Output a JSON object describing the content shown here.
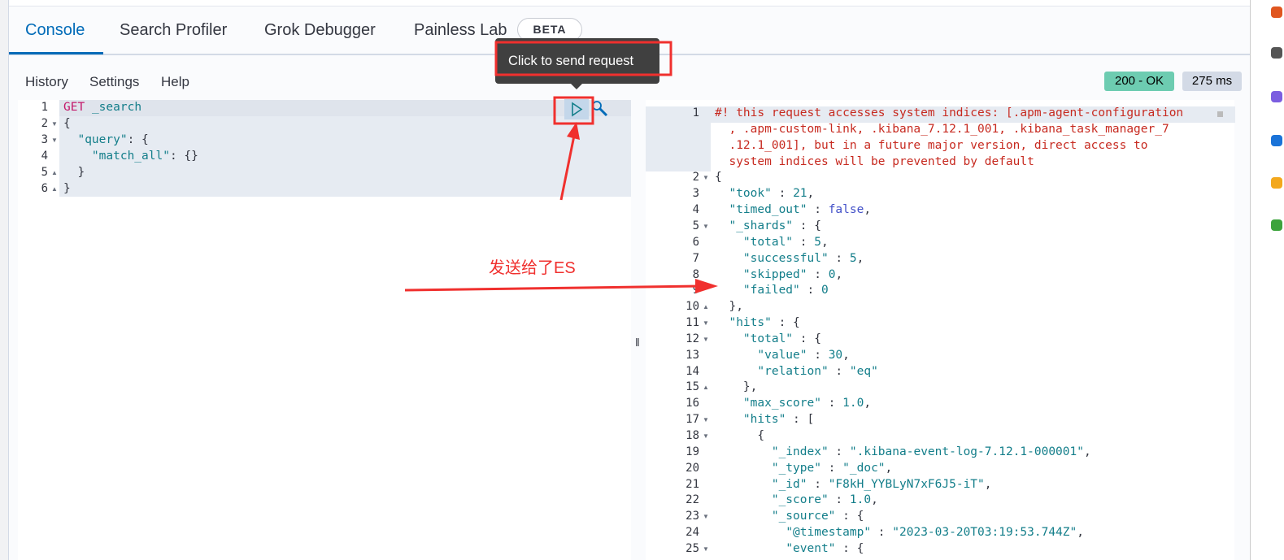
{
  "tabs": [
    {
      "label": "Console",
      "active": true
    },
    {
      "label": "Search Profiler"
    },
    {
      "label": "Grok Debugger"
    },
    {
      "label": "Painless Lab"
    }
  ],
  "beta_badge": "BETA",
  "menu": {
    "history": "History",
    "settings": "Settings",
    "help": "Help"
  },
  "status": {
    "code": "200 - OK",
    "time": "275 ms",
    "ok_color": "#6dccb1",
    "time_color": "#d3dae6"
  },
  "tooltip": "Click to send request",
  "annotation": "发送给了ES",
  "request_lines": [
    {
      "n": "1",
      "fold": "",
      "seg": [
        [
          "m",
          "GET"
        ],
        [
          "p",
          " "
        ],
        [
          "n",
          "_search"
        ]
      ]
    },
    {
      "n": "2",
      "fold": "▼",
      "seg": [
        [
          "p",
          "{"
        ]
      ]
    },
    {
      "n": "3",
      "fold": "▼",
      "seg": [
        [
          "p",
          "  "
        ],
        [
          "k",
          "\"query\""
        ],
        [
          "p",
          ": {"
        ]
      ]
    },
    {
      "n": "4",
      "fold": "",
      "seg": [
        [
          "p",
          "    "
        ],
        [
          "k",
          "\"match_all\""
        ],
        [
          "p",
          ": {}"
        ]
      ]
    },
    {
      "n": "5",
      "fold": "▲",
      "seg": [
        [
          "p",
          "  }"
        ]
      ]
    },
    {
      "n": "6",
      "fold": "▲",
      "seg": [
        [
          "p",
          "}"
        ]
      ]
    }
  ],
  "response_lines": [
    {
      "n": "1",
      "fold": "",
      "seg": [
        [
          "c",
          "#! this request accesses system indices: [.apm-agent-configuration"
        ]
      ]
    },
    {
      "n": "",
      "fold": "",
      "seg": [
        [
          "c",
          "  , .apm-custom-link, .kibana_7.12.1_001, .kibana_task_manager_7"
        ]
      ]
    },
    {
      "n": "",
      "fold": "",
      "seg": [
        [
          "c",
          "  .12.1_001], but in a future major version, direct access to"
        ]
      ]
    },
    {
      "n": "",
      "fold": "",
      "seg": [
        [
          "c",
          "  system indices will be prevented by default"
        ]
      ]
    },
    {
      "n": "2",
      "fold": "▼",
      "seg": [
        [
          "p",
          "{"
        ]
      ]
    },
    {
      "n": "3",
      "fold": "",
      "seg": [
        [
          "p",
          "  "
        ],
        [
          "k",
          "\"took\""
        ],
        [
          "p",
          " : "
        ],
        [
          "n",
          "21"
        ],
        [
          "p",
          ","
        ]
      ]
    },
    {
      "n": "4",
      "fold": "",
      "seg": [
        [
          "p",
          "  "
        ],
        [
          "k",
          "\"timed_out\""
        ],
        [
          "p",
          " : "
        ],
        [
          "b",
          "false"
        ],
        [
          "p",
          ","
        ]
      ]
    },
    {
      "n": "5",
      "fold": "▼",
      "seg": [
        [
          "p",
          "  "
        ],
        [
          "k",
          "\"_shards\""
        ],
        [
          "p",
          " : {"
        ]
      ]
    },
    {
      "n": "6",
      "fold": "",
      "seg": [
        [
          "p",
          "    "
        ],
        [
          "k",
          "\"total\""
        ],
        [
          "p",
          " : "
        ],
        [
          "n",
          "5"
        ],
        [
          "p",
          ","
        ]
      ]
    },
    {
      "n": "7",
      "fold": "",
      "seg": [
        [
          "p",
          "    "
        ],
        [
          "k",
          "\"successful\""
        ],
        [
          "p",
          " : "
        ],
        [
          "n",
          "5"
        ],
        [
          "p",
          ","
        ]
      ]
    },
    {
      "n": "8",
      "fold": "",
      "seg": [
        [
          "p",
          "    "
        ],
        [
          "k",
          "\"skipped\""
        ],
        [
          "p",
          " : "
        ],
        [
          "n",
          "0"
        ],
        [
          "p",
          ","
        ]
      ]
    },
    {
      "n": "9",
      "fold": "",
      "seg": [
        [
          "p",
          "    "
        ],
        [
          "k",
          "\"failed\""
        ],
        [
          "p",
          " : "
        ],
        [
          "n",
          "0"
        ]
      ]
    },
    {
      "n": "10",
      "fold": "▲",
      "seg": [
        [
          "p",
          "  },"
        ]
      ]
    },
    {
      "n": "11",
      "fold": "▼",
      "seg": [
        [
          "p",
          "  "
        ],
        [
          "k",
          "\"hits\""
        ],
        [
          "p",
          " : {"
        ]
      ]
    },
    {
      "n": "12",
      "fold": "▼",
      "seg": [
        [
          "p",
          "    "
        ],
        [
          "k",
          "\"total\""
        ],
        [
          "p",
          " : {"
        ]
      ]
    },
    {
      "n": "13",
      "fold": "",
      "seg": [
        [
          "p",
          "      "
        ],
        [
          "k",
          "\"value\""
        ],
        [
          "p",
          " : "
        ],
        [
          "n",
          "30"
        ],
        [
          "p",
          ","
        ]
      ]
    },
    {
      "n": "14",
      "fold": "",
      "seg": [
        [
          "p",
          "      "
        ],
        [
          "k",
          "\"relation\""
        ],
        [
          "p",
          " : "
        ],
        [
          "s",
          "\"eq\""
        ]
      ]
    },
    {
      "n": "15",
      "fold": "▲",
      "seg": [
        [
          "p",
          "    },"
        ]
      ]
    },
    {
      "n": "16",
      "fold": "",
      "seg": [
        [
          "p",
          "    "
        ],
        [
          "k",
          "\"max_score\""
        ],
        [
          "p",
          " : "
        ],
        [
          "n",
          "1.0"
        ],
        [
          "p",
          ","
        ]
      ]
    },
    {
      "n": "17",
      "fold": "▼",
      "seg": [
        [
          "p",
          "    "
        ],
        [
          "k",
          "\"hits\""
        ],
        [
          "p",
          " : ["
        ]
      ]
    },
    {
      "n": "18",
      "fold": "▼",
      "seg": [
        [
          "p",
          "      {"
        ]
      ]
    },
    {
      "n": "19",
      "fold": "",
      "seg": [
        [
          "p",
          "        "
        ],
        [
          "k",
          "\"_index\""
        ],
        [
          "p",
          " : "
        ],
        [
          "s",
          "\".kibana-event-log-7.12.1-000001\""
        ],
        [
          "p",
          ","
        ]
      ]
    },
    {
      "n": "20",
      "fold": "",
      "seg": [
        [
          "p",
          "        "
        ],
        [
          "k",
          "\"_type\""
        ],
        [
          "p",
          " : "
        ],
        [
          "s",
          "\"_doc\""
        ],
        [
          "p",
          ","
        ]
      ]
    },
    {
      "n": "21",
      "fold": "",
      "seg": [
        [
          "p",
          "        "
        ],
        [
          "k",
          "\"_id\""
        ],
        [
          "p",
          " : "
        ],
        [
          "s",
          "\"F8kH_YYBLyN7xF6J5-iT\""
        ],
        [
          "p",
          ","
        ]
      ]
    },
    {
      "n": "22",
      "fold": "",
      "seg": [
        [
          "p",
          "        "
        ],
        [
          "k",
          "\"_score\""
        ],
        [
          "p",
          " : "
        ],
        [
          "n",
          "1.0"
        ],
        [
          "p",
          ","
        ]
      ]
    },
    {
      "n": "23",
      "fold": "▼",
      "seg": [
        [
          "p",
          "        "
        ],
        [
          "k",
          "\"_source\""
        ],
        [
          "p",
          " : {"
        ]
      ]
    },
    {
      "n": "24",
      "fold": "",
      "seg": [
        [
          "p",
          "          "
        ],
        [
          "k",
          "\"@timestamp\""
        ],
        [
          "p",
          " : "
        ],
        [
          "s",
          "\"2023-03-20T03:19:53.744Z\""
        ],
        [
          "p",
          ","
        ]
      ]
    },
    {
      "n": "25",
      "fold": "▼",
      "seg": [
        [
          "p",
          "          "
        ],
        [
          "k",
          "\"event\""
        ],
        [
          "p",
          " : {"
        ]
      ]
    }
  ]
}
